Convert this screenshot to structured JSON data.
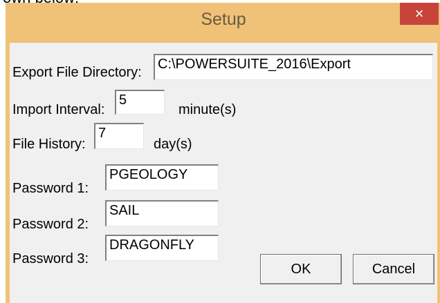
{
  "page": {
    "caption_fragment": "own below:"
  },
  "window": {
    "title": "Setup",
    "close_glyph": "×"
  },
  "form": {
    "export_dir": {
      "label": "Export File Directory:",
      "value": "C:\\POWERSUITE_2016\\Export"
    },
    "import_interval": {
      "label": "Import Interval:",
      "value": "5",
      "unit": "minute(s)"
    },
    "file_history": {
      "label": "File History:",
      "value": "7",
      "unit": "day(s)"
    },
    "password1": {
      "label": "Password 1:",
      "value": "PGEOLOGY"
    },
    "password2": {
      "label": "Password 2:",
      "value": "SAIL"
    },
    "password3": {
      "label": "Password 3:",
      "value": "DRAGONFLY"
    }
  },
  "buttons": {
    "ok": "OK",
    "cancel": "Cancel"
  },
  "colors": {
    "titlebar": "#f0c278",
    "close_button": "#c7443a",
    "client_bg": "#f0f0f0"
  }
}
